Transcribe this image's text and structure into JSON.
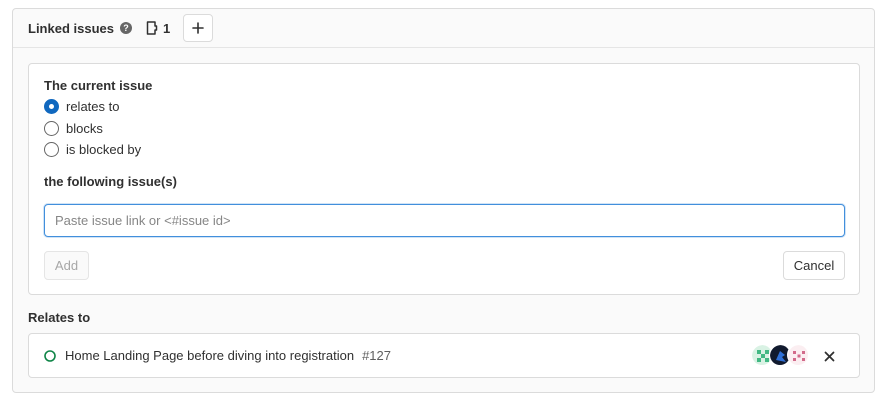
{
  "header": {
    "title": "Linked issues",
    "count": "1",
    "help_icon": "question-circle-icon",
    "issues_icon": "issues-icon",
    "add_icon": "plus-icon"
  },
  "form": {
    "current_issue_label": "The current issue",
    "options": [
      {
        "label": "relates to",
        "selected": true
      },
      {
        "label": "blocks",
        "selected": false
      },
      {
        "label": "is blocked by",
        "selected": false
      }
    ],
    "following_label": "the following issue(s)",
    "input_placeholder": "Paste issue link or <#issue id>",
    "input_value": "",
    "add_label": "Add",
    "cancel_label": "Cancel"
  },
  "relates": {
    "heading": "Relates to",
    "items": [
      {
        "title": "Home Landing Page before diving into registration",
        "ref": "#127",
        "status": "open",
        "status_icon": "issue-open-icon",
        "avatars": [
          "green-identicon",
          "dark-blue-avatar",
          "pink-identicon"
        ],
        "remove_icon": "close-icon"
      }
    ]
  },
  "colors": {
    "accent": "#1068bf",
    "focus": "#428fdc",
    "open_status": "#108548",
    "border": "#dbdbdb"
  }
}
